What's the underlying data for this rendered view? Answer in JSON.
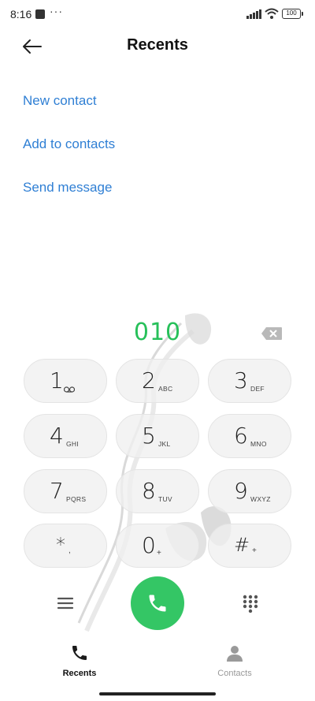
{
  "status_bar": {
    "time": "8:16",
    "dots": "···",
    "battery": "100"
  },
  "header": {
    "title": "Recents"
  },
  "actions": [
    {
      "label": "New contact"
    },
    {
      "label": "Add to contacts"
    },
    {
      "label": "Send message"
    }
  ],
  "dialer": {
    "number": "010",
    "keys": [
      {
        "digit": "1",
        "letters": "voicemail"
      },
      {
        "digit": "2",
        "letters": "ABC"
      },
      {
        "digit": "3",
        "letters": "DEF"
      },
      {
        "digit": "4",
        "letters": "GHI"
      },
      {
        "digit": "5",
        "letters": "JKL"
      },
      {
        "digit": "6",
        "letters": "MNO"
      },
      {
        "digit": "7",
        "letters": "PQRS"
      },
      {
        "digit": "8",
        "letters": "TUV"
      },
      {
        "digit": "9",
        "letters": "WXYZ"
      },
      {
        "digit": "*",
        "letters": ","
      },
      {
        "digit": "0",
        "letters": "+"
      },
      {
        "digit": "#",
        "letters": "+"
      }
    ]
  },
  "tabs": [
    {
      "label": "Recents",
      "icon": "phone-icon",
      "active": true
    },
    {
      "label": "Contacts",
      "icon": "person-icon",
      "active": false
    }
  ],
  "colors": {
    "accent": "#2f7fd4",
    "dial_green": "#27c05a",
    "call_button": "#34c665"
  }
}
